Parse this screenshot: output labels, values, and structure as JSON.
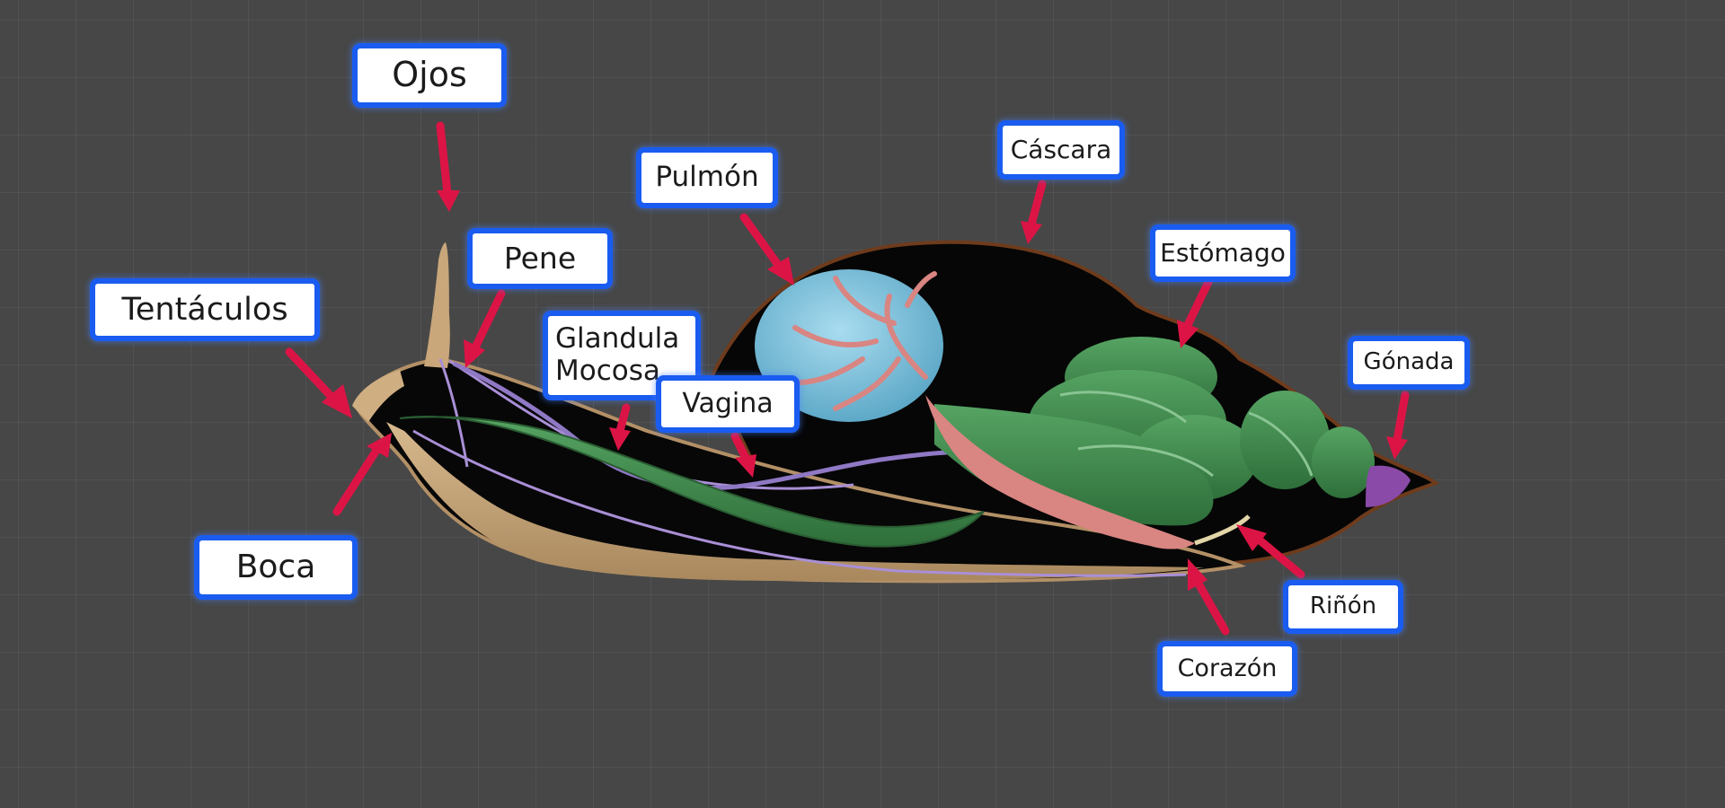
{
  "labels": {
    "ojos": "Ojos",
    "tentaculos": "Tentáculos",
    "pene": "Pene",
    "boca": "Boca",
    "glandula": "Glandula\nMocosa",
    "vagina": "Vagina",
    "pulmon": "Pulmón",
    "cascara": "Cáscara",
    "estomago": "Estómago",
    "gonada": "Gónada",
    "rinon": "Riñón",
    "corazon": "Corazón"
  },
  "colors": {
    "background": "#474747",
    "label_border": "#1a5cf0",
    "arrow": "#dc1446",
    "lung": "#7ec3de",
    "vessels": "#d98582",
    "digestive": "#3f8a4c",
    "gonad": "#8a4aa8",
    "body_tan": "#c9a77b",
    "interior": "#050505",
    "nerves": "#a98fd6"
  }
}
